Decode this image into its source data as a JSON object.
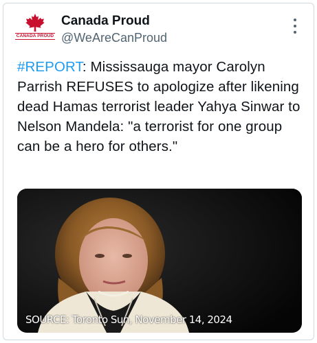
{
  "account": {
    "display_name": "Canada Proud",
    "handle": "@WeAreCanProud",
    "avatar_label": "CANADA PROUD"
  },
  "tweet": {
    "hashtag": "#REPORT",
    "body": ": Mississauga mayor Carolyn Parrish REFUSES to apologize after likening dead Hamas terrorist leader Yahya Sinwar to Nelson Mandela: \"a terrorist for one group can be a hero for others.\""
  },
  "media": {
    "caption": "SOURCE: Toronto Sun, November 14, 2024"
  },
  "colors": {
    "hashtag": "#1d9bf0",
    "brand_red": "#c8102e",
    "secondary_text": "#536471"
  },
  "icons": {
    "more": "more-vertical-icon",
    "logo": "maple-leaf-icon"
  }
}
